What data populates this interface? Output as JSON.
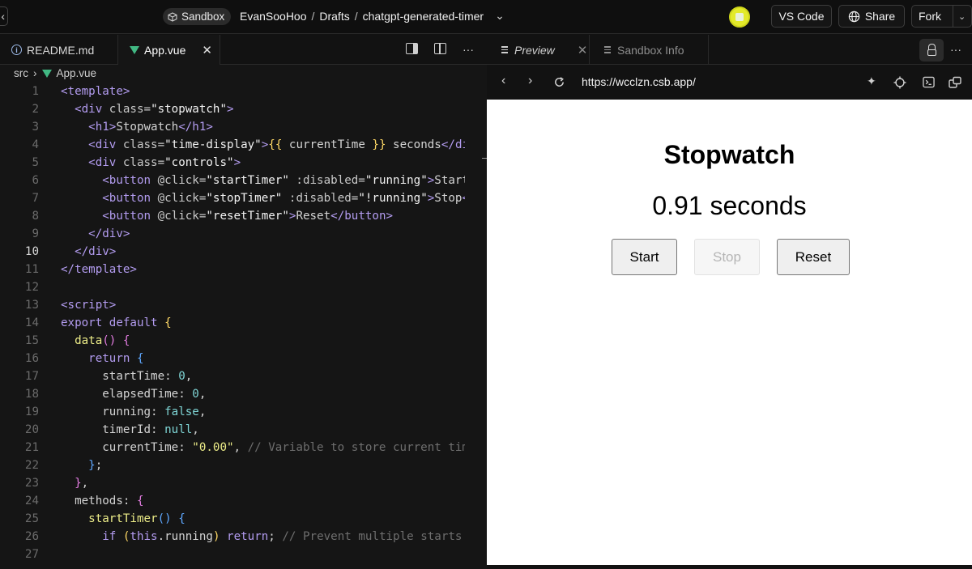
{
  "topbar": {
    "sandbox_label": "Sandbox",
    "crumbs": [
      "EvanSooHoo",
      "Drafts",
      "chatgpt-generated-timer"
    ],
    "separator": "/",
    "vscode_label": "VS Code",
    "share_label": "Share",
    "fork_label": "Fork"
  },
  "editor": {
    "tabs": [
      {
        "label": "README.md",
        "icon": "info-icon"
      },
      {
        "label": "App.vue",
        "icon": "vue-icon",
        "active": true
      }
    ],
    "breadcrumb": {
      "folder": "src",
      "file": "App.vue"
    },
    "active_line": 10,
    "lines": [
      {
        "n": "1"
      },
      {
        "n": "2"
      },
      {
        "n": "3"
      },
      {
        "n": "4"
      },
      {
        "n": "5"
      },
      {
        "n": "6"
      },
      {
        "n": "7"
      },
      {
        "n": "8"
      },
      {
        "n": "9"
      },
      {
        "n": "10"
      },
      {
        "n": "11"
      },
      {
        "n": "12"
      },
      {
        "n": "13"
      },
      {
        "n": "14"
      },
      {
        "n": "15"
      },
      {
        "n": "16"
      },
      {
        "n": "17"
      },
      {
        "n": "18"
      },
      {
        "n": "19"
      },
      {
        "n": "20"
      },
      {
        "n": "21"
      },
      {
        "n": "22"
      },
      {
        "n": "23"
      },
      {
        "n": "24"
      },
      {
        "n": "25"
      },
      {
        "n": "26"
      },
      {
        "n": "27"
      }
    ],
    "code": [
      [
        [
          "t-tag",
          "<template>"
        ]
      ],
      [
        [
          "t-plain",
          "  "
        ],
        [
          "t-tag",
          "<div"
        ],
        [
          "t-attr",
          " class="
        ],
        [
          "t-str",
          "\"stopwatch\""
        ],
        [
          "t-tag",
          ">"
        ]
      ],
      [
        [
          "t-plain",
          "    "
        ],
        [
          "t-tag",
          "<h1>"
        ],
        [
          "t-plain",
          "Stopwatch"
        ],
        [
          "t-tag",
          "</h1>"
        ]
      ],
      [
        [
          "t-plain",
          "    "
        ],
        [
          "t-tag",
          "<div"
        ],
        [
          "t-attr",
          " class="
        ],
        [
          "t-str",
          "\"time-display\""
        ],
        [
          "t-tag",
          ">"
        ],
        [
          "t-br1",
          "{{"
        ],
        [
          "t-plain",
          " currentTime "
        ],
        [
          "t-br1",
          "}}"
        ],
        [
          "t-plain",
          " seconds"
        ],
        [
          "t-tag",
          "</div>"
        ]
      ],
      [
        [
          "t-plain",
          "    "
        ],
        [
          "t-tag",
          "<div"
        ],
        [
          "t-attr",
          " class="
        ],
        [
          "t-str",
          "\"controls\""
        ],
        [
          "t-tag",
          ">"
        ]
      ],
      [
        [
          "t-plain",
          "      "
        ],
        [
          "t-tag",
          "<button"
        ],
        [
          "t-attr",
          " @click="
        ],
        [
          "t-str",
          "\"startTimer\""
        ],
        [
          "t-attr",
          " :disabled="
        ],
        [
          "t-str",
          "\"running\""
        ],
        [
          "t-tag",
          ">"
        ],
        [
          "t-plain",
          "Start"
        ],
        [
          "t-tag",
          "</button>"
        ]
      ],
      [
        [
          "t-plain",
          "      "
        ],
        [
          "t-tag",
          "<button"
        ],
        [
          "t-attr",
          " @click="
        ],
        [
          "t-str",
          "\"stopTimer\""
        ],
        [
          "t-attr",
          " :disabled="
        ],
        [
          "t-str",
          "\"!running\""
        ],
        [
          "t-tag",
          ">"
        ],
        [
          "t-plain",
          "Stop"
        ],
        [
          "t-tag",
          "</button>"
        ]
      ],
      [
        [
          "t-plain",
          "      "
        ],
        [
          "t-tag",
          "<button"
        ],
        [
          "t-attr",
          " @click="
        ],
        [
          "t-str",
          "\"resetTimer\""
        ],
        [
          "t-tag",
          ">"
        ],
        [
          "t-plain",
          "Reset"
        ],
        [
          "t-tag",
          "</button>"
        ]
      ],
      [
        [
          "t-plain",
          "    "
        ],
        [
          "t-tag",
          "</div>"
        ]
      ],
      [
        [
          "t-plain",
          "  "
        ],
        [
          "t-tag",
          "</div>"
        ]
      ],
      [
        [
          "t-tag",
          "</template>"
        ]
      ],
      [],
      [
        [
          "t-tag",
          "<script>"
        ]
      ],
      [
        [
          "t-kw",
          "export default "
        ],
        [
          "t-br1",
          "{"
        ]
      ],
      [
        [
          "t-plain",
          "  "
        ],
        [
          "t-fn",
          "data"
        ],
        [
          "t-br2",
          "()"
        ],
        [
          "t-plain",
          " "
        ],
        [
          "t-br2",
          "{"
        ]
      ],
      [
        [
          "t-plain",
          "    "
        ],
        [
          "t-kw",
          "return "
        ],
        [
          "t-br3",
          "{"
        ]
      ],
      [
        [
          "t-plain",
          "      startTime: "
        ],
        [
          "t-num",
          "0"
        ],
        [
          "t-plain",
          ","
        ]
      ],
      [
        [
          "t-plain",
          "      elapsedTime: "
        ],
        [
          "t-num",
          "0"
        ],
        [
          "t-plain",
          ","
        ]
      ],
      [
        [
          "t-plain",
          "      running: "
        ],
        [
          "t-num",
          "false"
        ],
        [
          "t-plain",
          ","
        ]
      ],
      [
        [
          "t-plain",
          "      timerId: "
        ],
        [
          "t-num",
          "null"
        ],
        [
          "t-plain",
          ","
        ]
      ],
      [
        [
          "t-plain",
          "      currentTime: "
        ],
        [
          "t-fn",
          "\"0.00\""
        ],
        [
          "t-plain",
          ", "
        ],
        [
          "t-com",
          "// Variable to store current time"
        ]
      ],
      [
        [
          "t-plain",
          "    "
        ],
        [
          "t-br3",
          "}"
        ],
        [
          "t-plain",
          ";"
        ]
      ],
      [
        [
          "t-plain",
          "  "
        ],
        [
          "t-br2",
          "}"
        ],
        [
          "t-plain",
          ","
        ]
      ],
      [
        [
          "t-plain",
          "  methods: "
        ],
        [
          "t-br2",
          "{"
        ]
      ],
      [
        [
          "t-plain",
          "    "
        ],
        [
          "t-fn",
          "startTimer"
        ],
        [
          "t-br3",
          "()"
        ],
        [
          "t-plain",
          " "
        ],
        [
          "t-br3",
          "{"
        ]
      ],
      [
        [
          "t-plain",
          "      "
        ],
        [
          "t-kw",
          "if "
        ],
        [
          "t-br1",
          "("
        ],
        [
          "t-kw",
          "this"
        ],
        [
          "t-plain",
          ".running"
        ],
        [
          "t-br1",
          ")"
        ],
        [
          "t-kw",
          " return"
        ],
        [
          "t-plain",
          "; "
        ],
        [
          "t-com",
          "// Prevent multiple starts"
        ]
      ],
      []
    ]
  },
  "preview": {
    "tabs": [
      {
        "label": "Preview",
        "active": true
      },
      {
        "label": "Sandbox Info"
      }
    ],
    "url": "https://wcclzn.csb.app/",
    "app": {
      "title": "Stopwatch",
      "time_display": "0.91 seconds",
      "start_label": "Start",
      "stop_label": "Stop",
      "reset_label": "Reset",
      "stop_disabled": true
    }
  },
  "colors": {
    "vue": "#41b883",
    "tag": "#b39cf0",
    "avatar": "#e3ea2a"
  }
}
